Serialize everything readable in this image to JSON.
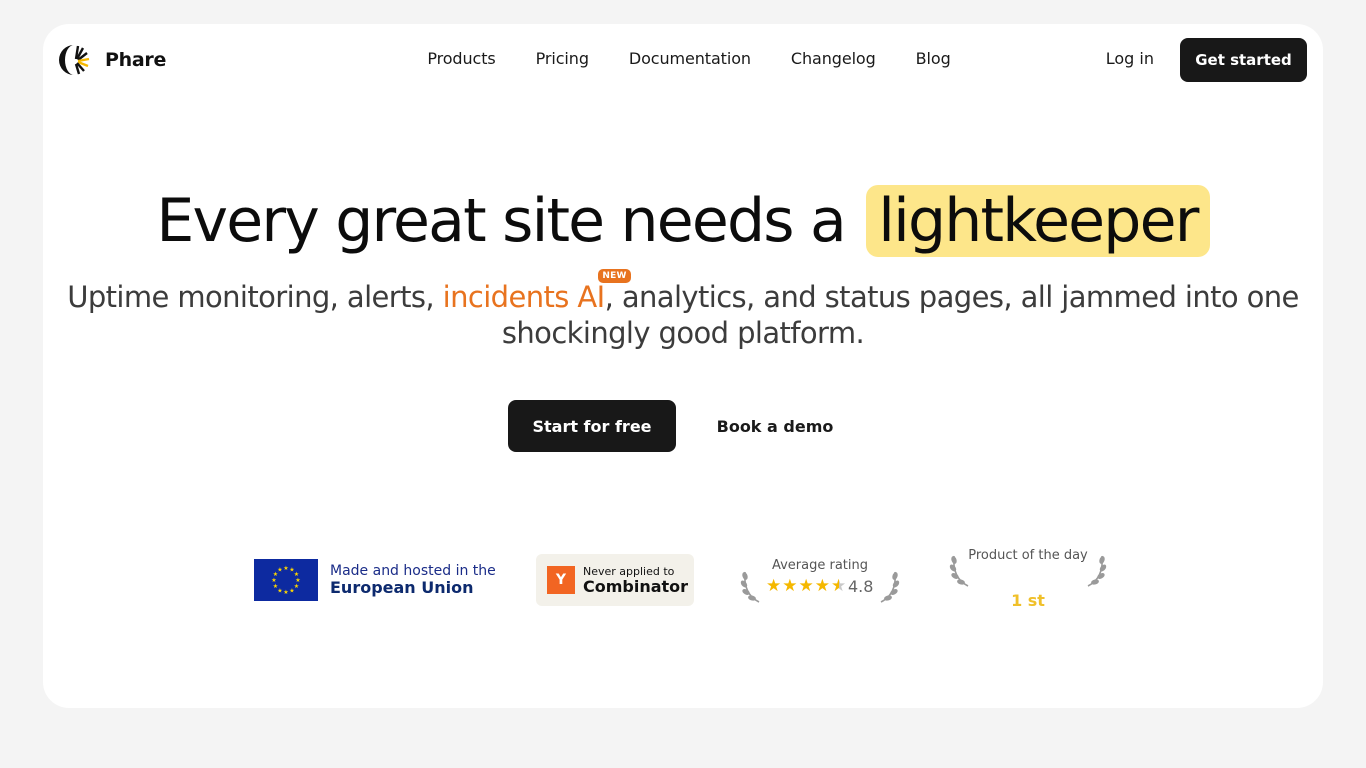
{
  "brand": {
    "name": "Phare"
  },
  "nav": {
    "links": [
      "Products",
      "Pricing",
      "Documentation",
      "Changelog",
      "Blog"
    ],
    "login": "Log in",
    "cta": "Get started"
  },
  "hero": {
    "headline_prefix": "Every great site needs a",
    "headline_highlight": "lightkeeper",
    "sub_part1": "Uptime monitoring, alerts, ",
    "sub_highlight": "incidents AI",
    "sub_badge": "NEW",
    "sub_part2": ", analytics, and status pages, all jammed into one shockingly good platform.",
    "primary_cta": "Start for free",
    "secondary_cta": "Book a demo"
  },
  "badges": {
    "eu": {
      "line1": "Made and hosted in the",
      "line2": "European Union"
    },
    "yc": {
      "logo_letter": "Y",
      "line1": "Never applied to",
      "line2": "Combinator"
    },
    "rating": {
      "label": "Average rating",
      "stars": 4.5,
      "value": "4.8"
    },
    "product_of_day": {
      "label": "Product of the day",
      "rank": "1 st"
    }
  },
  "colors": {
    "accent_orange": "#e8731f",
    "highlight_yellow": "#fde68a",
    "button_dark": "#181818",
    "eu_blue": "#0d2aa0",
    "yc_orange": "#f26522",
    "star_gold": "#f5b800"
  },
  "icons": {
    "logo": "lighthouse-beam-icon",
    "eu_flag": "eu-flag-icon",
    "laurel": "laurel-wreath-icon",
    "star": "star-icon"
  }
}
